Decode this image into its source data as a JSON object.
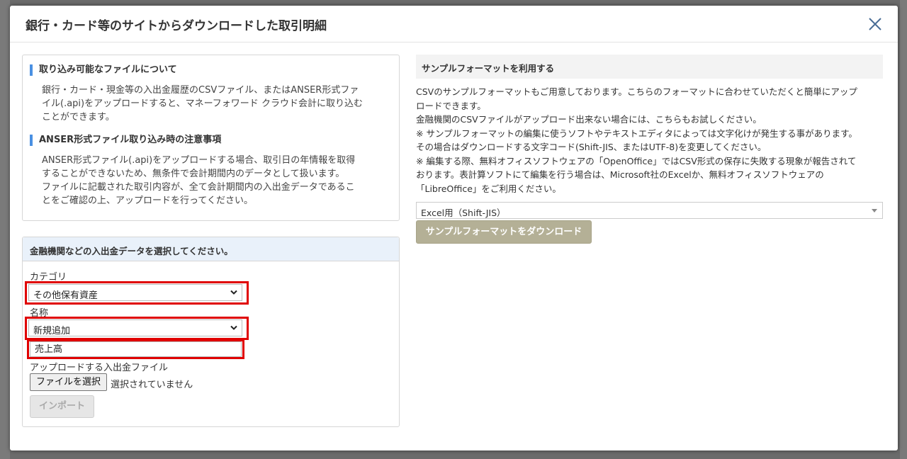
{
  "modal": {
    "title": "銀行・カード等のサイトからダウンロードした取引明細"
  },
  "info": {
    "section1_title": "取り込み可能なファイルについて",
    "section1_lines": [
      "銀行・カード・現金等の入出金履歴のCSVファイル、またはANSER形式ファ",
      "イル(.api)をアップロードすると、マネーフォワード クラウド会計に取り込む",
      "ことができます。"
    ],
    "section2_title": "ANSER形式ファイル取り込み時の注意事項",
    "section2_lines": [
      "ANSER形式ファイル(.api)をアップロードする場合、取引日の年情報を取得",
      "することができないため、無条件で会計期間内のデータとして扱います。",
      "ファイルに記載された取引内容が、全て会計期間内の入出金データであるこ",
      "とをご確認の上、アップロードを行ってください。"
    ]
  },
  "select_panel": {
    "title": "金融機関などの入出金データを選択してください。",
    "category_label": "カテゴリ",
    "category_value": "その他保有資産",
    "name_label": "名称",
    "name_value": "新規追加",
    "new_name_value": "売上高",
    "file_label": "アップロードする入出金ファイル",
    "file_button": "ファイルを選択",
    "file_status": "選択されていません",
    "import_button": "インポート"
  },
  "sample": {
    "title": "サンプルフォーマットを利用する",
    "lines": [
      "CSVのサンプルフォーマットもご用意しております。こちらのフォーマットに合わせていただくと簡単にアップ",
      "ロードできます。",
      "金融機関のCSVファイルがアップロード出来ない場合には、こちらもお試しください。",
      "※ サンプルフォーマットの編集に使うソフトやテキストエディタによっては文字化けが発生する事があります。",
      "その場合はダウンロードする文字コード(Shift-JIS、またはUTF-8)を変更してください。",
      "※ 編集する際、無料オフィスソフトウェアの「OpenOffice」ではCSV形式の保存に失敗する現象が報告されて",
      "おります。表計算ソフトにて編集を行う場合は、Microsoft社のExcelか、無料オフィスソフトウェアの",
      "「LibreOffice」をご利用ください。"
    ],
    "format_value": "Excel用（Shift-JIS）",
    "download_button": "サンプルフォーマットをダウンロード"
  },
  "colors": {
    "highlight": "#e00000",
    "accent": "#4a90e2",
    "download_button": "#b4b096"
  }
}
